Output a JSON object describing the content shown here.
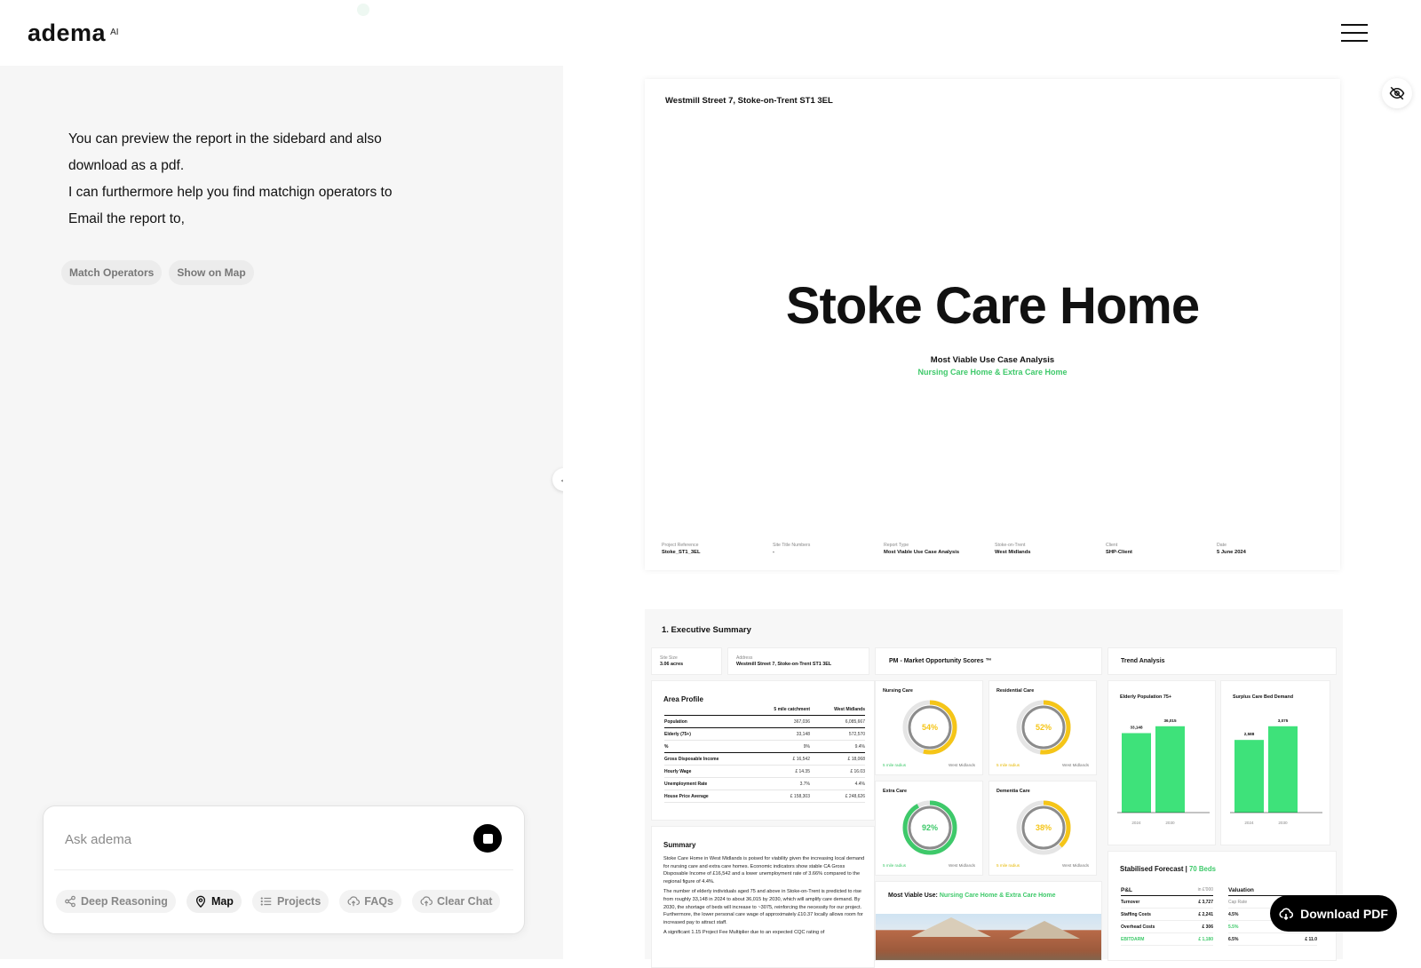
{
  "app": {
    "logo": "adema",
    "logo_sup": "AI"
  },
  "chat": {
    "message_lines": [
      "You can preview the report in the sidebard and also",
      "download as a pdf.",
      "I can furthermore help you find matchign operators to",
      "Email the report to,"
    ],
    "chips": [
      "Match Operators",
      "Show on Map"
    ]
  },
  "composer": {
    "placeholder": "Ask adema",
    "tools": [
      {
        "label": "Deep Reasoning",
        "icon": "share-nodes-icon"
      },
      {
        "label": "Map",
        "icon": "map-pin-icon"
      },
      {
        "label": "Projects",
        "icon": "list-icon"
      },
      {
        "label": "FAQs",
        "icon": "cloud-upload-icon"
      },
      {
        "label": "Clear Chat",
        "icon": "cloud-upload-icon"
      }
    ]
  },
  "report": {
    "cover": {
      "address": "Westmill Street 7, Stoke-on-Trent ST1 3EL",
      "title": "Stoke Care Home",
      "subtitle": "Most Viable Use Case Analysis",
      "subtitle2": "Nursing Care Home & Extra Care Home",
      "meta": [
        {
          "label": "Project Reference",
          "value": "Stoke_ST1_3EL"
        },
        {
          "label": "Site Title Numbers",
          "value": "-"
        },
        {
          "label": "Report Type",
          "value": "Most Viable Use Case Analysis"
        },
        {
          "label": "Stoke-on-Trent",
          "value": "West Midlands"
        },
        {
          "label": "Client",
          "value": "SHP-Client"
        },
        {
          "label": "Date",
          "value": "5 June 2024"
        }
      ]
    },
    "exec": {
      "title": "1. Executive Summary",
      "site_size_label": "Site Size",
      "site_size_value": "3.06 acres",
      "address_label": "Address",
      "address_value": "Westmill Street 7, Stoke-on-Trent ST1 3EL",
      "scores_title": "PM - Market Opportunity Scores ™",
      "trend_title": "Trend Analysis",
      "area_profile": {
        "title": "Area Profile",
        "col1": "5 mile catchment",
        "col2": "West Midlands",
        "rows": [
          {
            "label": "Population",
            "a": "367,036",
            "b": "6,085,667",
            "thick": true
          },
          {
            "label": "Elderly (75+)",
            "a": "33,148",
            "b": "572,570",
            "thick": false
          },
          {
            "label": "%",
            "a": "9%",
            "b": "9.4%",
            "thick": true
          },
          {
            "label": "Gross Disposable Income",
            "a": "£ 16,542",
            "b": "£ 18,068",
            "thick": false
          },
          {
            "label": "Hourly Wage",
            "a": "£ 14.35",
            "b": "£ 16.03",
            "thick": false
          },
          {
            "label": "Unemployment Rate",
            "a": "3.7%",
            "b": "4.4%",
            "thick": false
          },
          {
            "label": "House Price Average",
            "a": "£ 158,303",
            "b": "£ 248,626",
            "thick": false
          }
        ]
      },
      "summary": {
        "title": "Summary",
        "paragraphs": [
          "Stoke Care Home in West Midlands is poised for viability given the increasing local demand for nursing care and extra care homes. Economic indicators show stable CA Gross Disposable Income of £16,542 and a lower unemployment rate of 3.66% compared to the regional figure of 4.4%.",
          "The number of elderly individuals aged 75 and above in Stoke-on-Trent is predicted to rise from roughly 33,148 in 2024 to about 36,015 by 2030, which will amplify care demand. By 2030, the shortage of beds will increase to ~3075, reinforcing the necessity for our project. Furthermore, the lower personal care wage of approximately £10.37 locally allows room for increased pay to attract staff.",
          "A significant 1.15 Project Fee Multiplier due to an expected CQC rating of"
        ]
      },
      "scores": [
        {
          "label": "Nursing Care",
          "pct": 54,
          "pct_text": "54%",
          "color": "#f5c518",
          "catchment": "5 mile radius",
          "region": "West Midlands",
          "tone": "g"
        },
        {
          "label": "Residential Care",
          "pct": 52,
          "pct_text": "52%",
          "color": "#f5c518",
          "catchment": "5 mile radius",
          "region": "West Midlands",
          "tone": "y"
        },
        {
          "label": "Extra Care",
          "pct": 92,
          "pct_text": "92%",
          "color": "#3ec96a",
          "catchment": "5 mile radius",
          "region": "West Midlands",
          "tone": "g"
        },
        {
          "label": "Dementia Care",
          "pct": 38,
          "pct_text": "38%",
          "color": "#f5c518",
          "catchment": "5 mile radius",
          "region": "West Midlands",
          "tone": "y"
        }
      ],
      "most_viable_label": "Most Viable Use:",
      "most_viable_value": "Nursing Care Home & Extra Care Home",
      "trends": [
        {
          "title": "Elderly Population 75+",
          "categories": [
            "2024",
            "2030"
          ],
          "values": [
            33148,
            36015
          ],
          "value_labels": [
            "33,148",
            "36,015"
          ]
        },
        {
          "title": "Surplus Care Bed Demand",
          "categories": [
            "2024",
            "2030"
          ],
          "values": [
            2588,
            3075
          ],
          "value_labels": [
            "2,588",
            "3,075"
          ]
        }
      ],
      "stabilised": {
        "title": "Stabilised Forecast |",
        "title_accent": "70 Beds",
        "pl_title": "P&L",
        "pl_unit": "in £'000",
        "pl_rows": [
          {
            "label": "Turnover",
            "value": "£ 3,727"
          },
          {
            "label": "Staffing Costs",
            "value": "£ 2,241"
          },
          {
            "label": "Overhead Costs",
            "value": "£ 306"
          },
          {
            "label": "EBITDARM",
            "value": "£ 1,180"
          }
        ],
        "val_title": "Valuation",
        "val_rows": [
          {
            "label": "Cap Rate",
            "value": ""
          },
          {
            "label": "4.5%",
            "value": ""
          },
          {
            "label": "5.5%",
            "value": "£ 13.0"
          },
          {
            "label": "6.5%",
            "value": "£ 11.0"
          }
        ]
      }
    }
  },
  "download_label": "Download PDF",
  "colors": {
    "accent_green": "#3ec96a",
    "accent_yellow": "#f5c518",
    "dark": "#000000"
  }
}
